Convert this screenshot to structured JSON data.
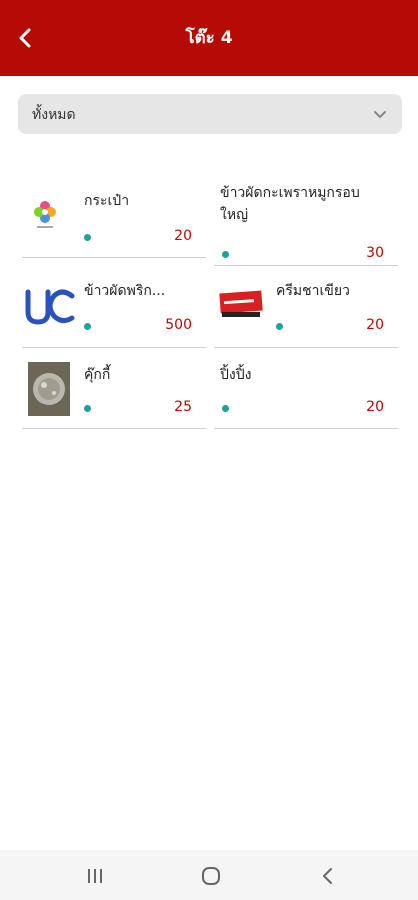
{
  "header": {
    "title": "โต๊ะ 4",
    "back_icon": "chevron-left-icon"
  },
  "filter": {
    "selected": "ทั้งหมด",
    "icon": "chevron-down-icon"
  },
  "items": [
    {
      "name": "กระเป๋า",
      "qty": "20",
      "thumb": "logo-thumbnail"
    },
    {
      "name": "ข้าวผัดกะเพราหมูกรอบใหญ่",
      "qty": "30",
      "thumb": ""
    },
    {
      "name": "ข้าวผัดพริก...",
      "qty": "500",
      "thumb": "uc-logo-thumbnail"
    },
    {
      "name": "ครีมชาเขียว",
      "qty": "20",
      "thumb": "red-label-thumbnail"
    },
    {
      "name": "คุ๊กกี้",
      "qty": "25",
      "thumb": "photo-thumbnail"
    },
    {
      "name": "ปิ้งปิ้ง",
      "qty": "20",
      "thumb": ""
    }
  ],
  "colors": {
    "brand": "#b40c05",
    "status_dot": "#1aa39a",
    "qty_text": "#b40c05"
  },
  "navbar": {
    "icons": [
      "recent-apps-icon",
      "home-icon",
      "back-icon"
    ]
  }
}
